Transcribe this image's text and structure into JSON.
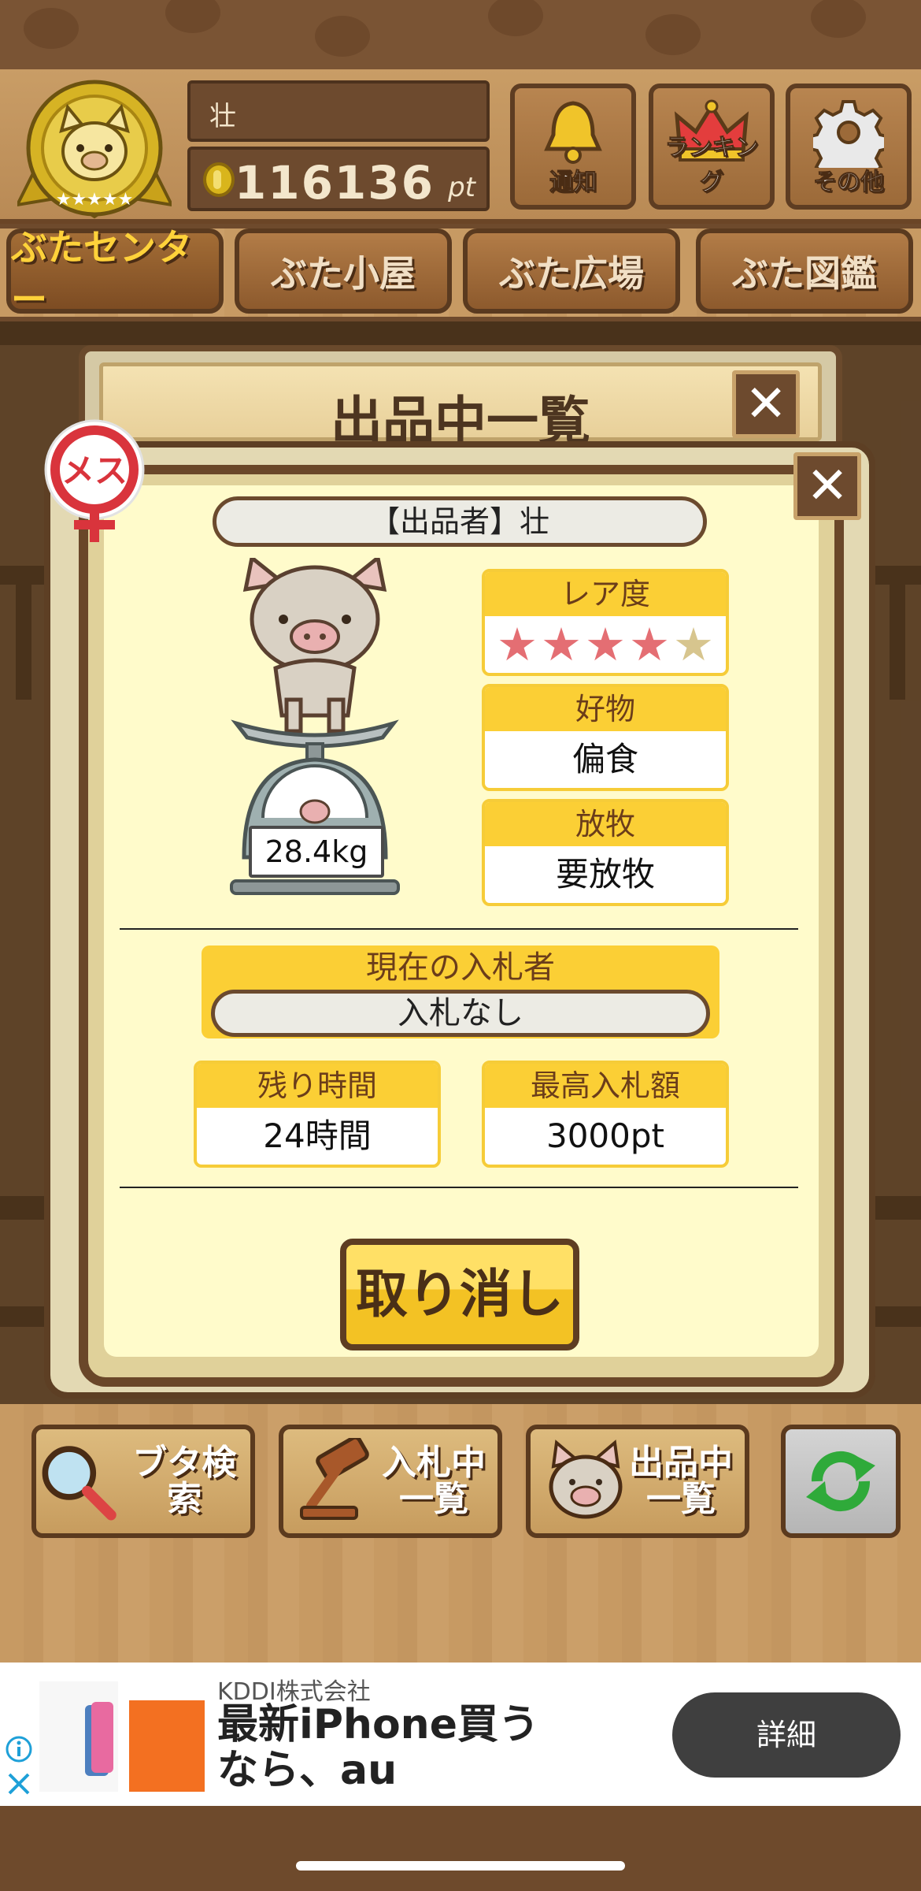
{
  "header": {
    "player_name": "壮",
    "points": "116136",
    "points_unit": "pt",
    "buttons": [
      {
        "label": "通知",
        "icon": "bell-icon"
      },
      {
        "label": "ランキング",
        "icon": "crown-icon"
      },
      {
        "label": "その他",
        "icon": "gear-icon"
      }
    ]
  },
  "tabs": [
    "ぶたセンター",
    "ぶた小屋",
    "ぶた広場",
    "ぶた図鑑"
  ],
  "back_window": {
    "title": "出品中一覧"
  },
  "listing": {
    "gender": "メス",
    "seller": "【出品者】壮",
    "weight": "28.4kg",
    "rarity_label": "レア度",
    "rarity": 4,
    "rarity_max": 5,
    "favorite_label": "好物",
    "favorite": "偏食",
    "grazing_label": "放牧",
    "grazing": "要放牧",
    "bidder_label": "現在の入札者",
    "bidder": "入札なし",
    "time_label": "残り時間",
    "time": "24時間",
    "maxbid_label": "最高入札額",
    "maxbid": "3000pt",
    "cancel_label": "取り消し"
  },
  "actions": [
    {
      "label": "ブタ検索",
      "icon": "magnifier-icon"
    },
    {
      "label": "入札中\n一覧",
      "icon": "gavel-icon"
    },
    {
      "label": "出品中\n一覧",
      "icon": "pig-face-icon"
    },
    {
      "label": "",
      "icon": "refresh-icon"
    }
  ],
  "ad": {
    "company": "KDDI株式会社",
    "title": "最新iPhone買うなら、au",
    "button": "詳細"
  },
  "colors": {
    "accent_yellow": "#fbcf35",
    "wood_dark": "#5e3d22",
    "star_on": "#e46e73",
    "modal_bg": "#fffbcb"
  }
}
